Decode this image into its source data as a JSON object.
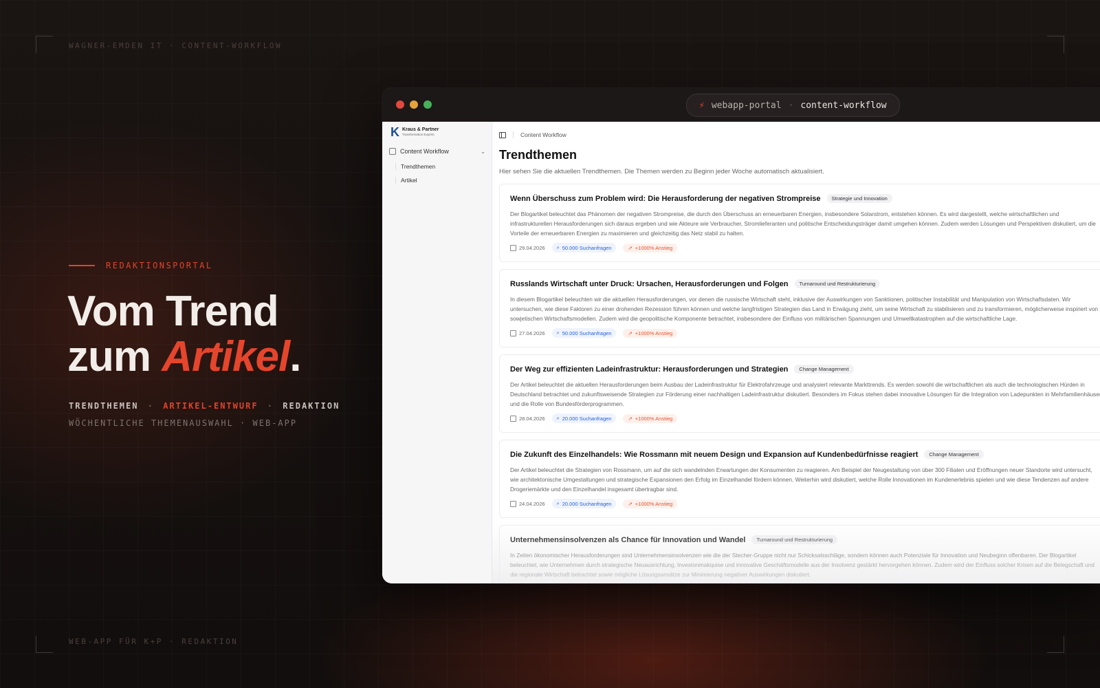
{
  "hero": {
    "top_tag": "WAGNER-EMDEN IT · CONTENT-WORKFLOW",
    "eyebrow": "REDAKTIONSPORTAL",
    "headline_line1": "Vom Trend",
    "headline_line2_prefix": "zum ",
    "headline_accent": "Artikel",
    "headline_period": ".",
    "meta_line1_part1": "TRENDTHEMEN",
    "meta_line1_part2": "ARTIKEL-ENTWURF",
    "meta_line1_part3": "REDAKTION",
    "meta_line1_separator": "·",
    "meta_line2": "WÖCHENTLICHE THEMENAUSWAHL · WEB-APP",
    "bottom_tag": "WEB-APP FÜR K+P · REDAKTION",
    "accent_color": "#e5452c"
  },
  "window": {
    "url_host": "webapp-portal",
    "url_separator": "·",
    "url_path": "content-workflow",
    "url_icon": "bolt-icon"
  },
  "sidebar": {
    "logo_letter": "K",
    "logo_name": "Kraus & Partner",
    "logo_subtitle": "Transformation Experts",
    "group_label": "Content Workflow",
    "items": [
      {
        "label": "Trendthemen"
      },
      {
        "label": "Artikel"
      }
    ]
  },
  "main": {
    "breadcrumb": "Content Workflow",
    "title": "Trendthemen",
    "description": "Hier sehen Sie die aktuellen Trendthemen. Die Themen werden zu Beginn jeder Woche automatisch aktualisiert.",
    "cards": [
      {
        "title": "Wenn Überschuss zum Problem wird: Die Herausforderung der negativen Strompreise",
        "badge": "Strategie und Innovation",
        "body": "Der Blogartikel beleuchtet das Phänomen der negativen Strompreise, die durch den Überschuss an erneuerbaren Energien, insbesondere Solarstrom, entstehen können. Es wird dargestellt, welche wirtschaftlichen und infrastrukturellen Herausforderungen sich daraus ergeben und wie Akteure wie Verbraucher, Stromlieferanten und politische Entscheidungsträger damit umgehen können. Zudem werden Lösungen und Perspektiven diskutiert, um die Vorteile der erneuerbaren Energien zu maximieren und gleichzeitig das Netz stabil zu halten.",
        "date": "29.04.2026",
        "searches": "50.000 Suchanfragen",
        "growth": "+1000% Anstieg"
      },
      {
        "title": "Russlands Wirtschaft unter Druck: Ursachen, Herausforderungen und Folgen",
        "badge": "Turnaround und Restrukturierung",
        "body": "In diesem Blogartikel beleuchten wir die aktuellen Herausforderungen, vor denen die russische Wirtschaft steht, inklusive der Auswirkungen von Sanktionen, politischer Instabilität und Manipulation von Wirtschaftsdaten. Wir untersuchen, wie diese Faktoren zu einer drohenden Rezession führen können und welche langfristigen Strategien das Land in Erwägung zieht, um seine Wirtschaft zu stabilisieren und zu transformieren, möglicherweise inspiriert von sowjetischen Wirtschaftsmodellen. Zudem wird die geopolitische Komponente betrachtet, insbesondere der Einfluss von militärischen Spannungen und Umweltkatastrophen auf die wirtschaftliche Lage.",
        "date": "27.04.2026",
        "searches": "50.000 Suchanfragen",
        "growth": "+1000% Anstieg"
      },
      {
        "title": "Der Weg zur effizienten Ladeinfrastruktur: Herausforderungen und Strategien",
        "badge": "Change Management",
        "body": "Der Artikel beleuchtet die aktuellen Herausforderungen beim Ausbau der Ladeinfrastruktur für Elektrofahrzeuge und analysiert relevante Markttrends. Es werden sowohl die wirtschaftlichen als auch die technologischen Hürden in Deutschland betrachtet und zukunftsweisende Strategien zur Förderung einer nachhaltigen Ladeinfrastruktur diskutiert. Besonders im Fokus stehen dabei innovative Lösungen für die Integration von Ladepunkten in Mehrfamilienhäuser und die Rolle von Bundesförderprogrammen.",
        "date": "28.04.2026",
        "searches": "20.000 Suchanfragen",
        "growth": "+1000% Anstieg"
      },
      {
        "title": "Die Zukunft des Einzelhandels: Wie Rossmann mit neuem Design und Expansion auf Kundenbedürfnisse reagiert",
        "badge": "Change Management",
        "body": "Der Artikel beleuchtet die Strategien von Rossmann, um auf die sich wandelnden Erwartungen der Konsumenten zu reagieren. Am Beispiel der Neugestaltung von über 300 Filialen und Eröffnungen neuer Standorte wird untersucht, wie architektonische Umgestaltungen und strategische Expansionen den Erfolg im Einzelhandel fördern können. Weiterhin wird diskutiert, welche Rolle Innovationen im Kundenerlebnis spielen und wie diese Tendenzen auf andere Drogeriemärkte und den Einzelhandel insgesamt übertragbar sind.",
        "date": "24.04.2026",
        "searches": "20.000 Suchanfragen",
        "growth": "+1000% Anstieg"
      },
      {
        "title": "Unternehmensinsolvenzen als Chance für Innovation und Wandel",
        "badge": "Turnaround und Restrukturierung",
        "body": "In Zeiten ökonomischer Herausforderungen sind Unternehmensinsolvenzen wie die der Stecher-Gruppe nicht nur Schicksalsschläge, sondern können auch Potenziale für Innovation und Neubeginn offenbaren. Der Blogartikel beleuchtet, wie Unternehmen durch strategische Neuausrichtung, Investorenakquise und innovative Geschäftsmodelle aus der Insolvenz gestärkt hervorgehen können. Zudem wird der Einfluss solcher Krisen auf die Belegschaft und die regionale Wirtschaft betrachtet sowie mögliche Lösungsansätze zur Minimierung negativer Auswirkungen diskutiert.",
        "date": "",
        "searches": "",
        "growth": ""
      }
    ]
  }
}
